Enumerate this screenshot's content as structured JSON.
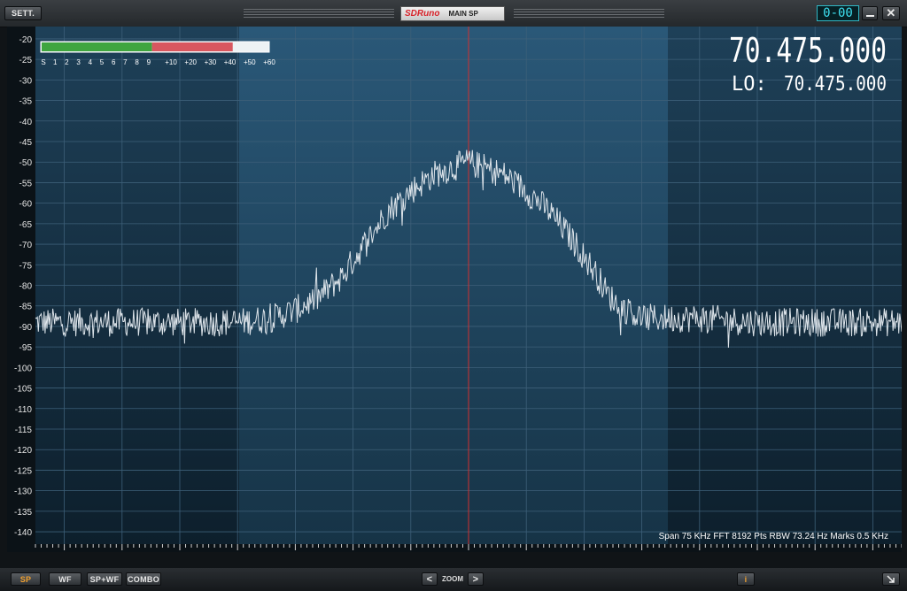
{
  "titlebar": {
    "settings_label": "SETT.",
    "brand_logo": "SDRuno",
    "panel_name": "MAIN SP",
    "clock_value": "0-00",
    "minimize_icon": "minimize-icon",
    "close_icon": "close-icon"
  },
  "display": {
    "frequency": "70.475.000",
    "lo_label": "LO:",
    "lo_frequency": "70.475.000",
    "info_line": "Span 75 KHz   FFT 8192 Pts   RBW 73.24 Hz   Marks 0.5 KHz"
  },
  "smeter": {
    "labels": [
      "S",
      "1",
      "2",
      "3",
      "4",
      "5",
      "6",
      "7",
      "8",
      "9",
      "+10",
      "+20",
      "+30",
      "+40",
      "+50",
      "+60"
    ],
    "level_fraction": 0.84,
    "colors": {
      "green": "#3fa53f",
      "red": "#d8575f"
    }
  },
  "chart_data": {
    "type": "line",
    "title": "",
    "xlabel": "",
    "ylabel": "",
    "x_ticks": [
      "70440",
      "70445",
      "70450",
      "70455",
      "70460",
      "70465",
      "70470",
      "70475",
      "70480",
      "70485",
      "70490",
      "70495",
      "70500",
      "70505",
      "70510"
    ],
    "y_ticks": [
      "-20",
      "-25",
      "-30",
      "-35",
      "-40",
      "-45",
      "-50",
      "-55",
      "-60",
      "-65",
      "-70",
      "-75",
      "-80",
      "-85",
      "-90",
      "-95",
      "-100",
      "-105",
      "-110",
      "-115",
      "-120",
      "-125",
      "-130",
      "-135",
      "-140"
    ],
    "xlim": [
      70437.5,
      70512.5
    ],
    "ylim": [
      -143,
      -17
    ],
    "series": [
      {
        "x": [
          70437.5,
          70440,
          70445,
          70450,
          70455,
          70458,
          70460,
          70462,
          70464,
          70466,
          70468,
          70470,
          70472,
          70474,
          70475,
          70476,
          70478,
          70480,
          70482,
          70484,
          70486,
          70487,
          70488,
          70490,
          70495,
          70500,
          70505,
          70510,
          70512.5
        ],
        "values": [
          -89,
          -89,
          -89,
          -89,
          -89,
          -88,
          -86,
          -83,
          -78,
          -70,
          -62,
          -57,
          -53,
          -51,
          -50,
          -51,
          -53,
          -57,
          -62,
          -69,
          -77,
          -82,
          -85,
          -88,
          -88,
          -89,
          -89,
          -89,
          -89
        ]
      }
    ],
    "center_marker": 70475,
    "grid": true,
    "trace_color": "#dde4ea",
    "marker_color": "#d23030",
    "background_color": "#1c3c52"
  },
  "bottombar": {
    "sp_label": "SP",
    "wf_label": "WF",
    "spwf_label": "SP+WF",
    "combo_label": "COMBO",
    "zoom_label": "ZOOM",
    "zoom_left": "<",
    "zoom_right": ">",
    "info_label": "i",
    "resize_icon": "resize-icon"
  }
}
